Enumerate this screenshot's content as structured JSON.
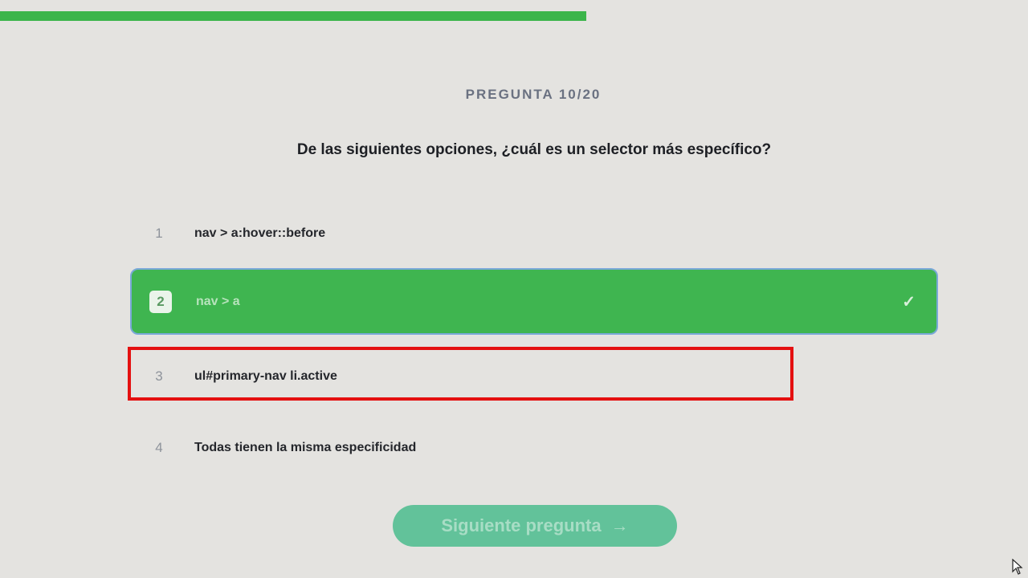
{
  "progress": {
    "fraction": 0.57,
    "color": "#3bb54a"
  },
  "header": {
    "counter": "PREGUNTA 10/20"
  },
  "question": {
    "text": "De las siguientes opciones, ¿cuál es un selector más específico?"
  },
  "options": [
    {
      "number": "1",
      "text": "nav > a:hover::before",
      "selected": false
    },
    {
      "number": "2",
      "text": "nav > a",
      "selected": true,
      "icon": "check-icon"
    },
    {
      "number": "3",
      "text": "ul#primary-nav li.active",
      "selected": false,
      "highlighted": true
    },
    {
      "number": "4",
      "text": "Todas tienen la misma especificidad",
      "selected": false
    }
  ],
  "next_button": {
    "label": "Siguiente pregunta",
    "icon": "arrow-right-icon"
  },
  "colors": {
    "accent": "#3fb550",
    "highlight": "#e41010",
    "button": "#62c29a"
  }
}
